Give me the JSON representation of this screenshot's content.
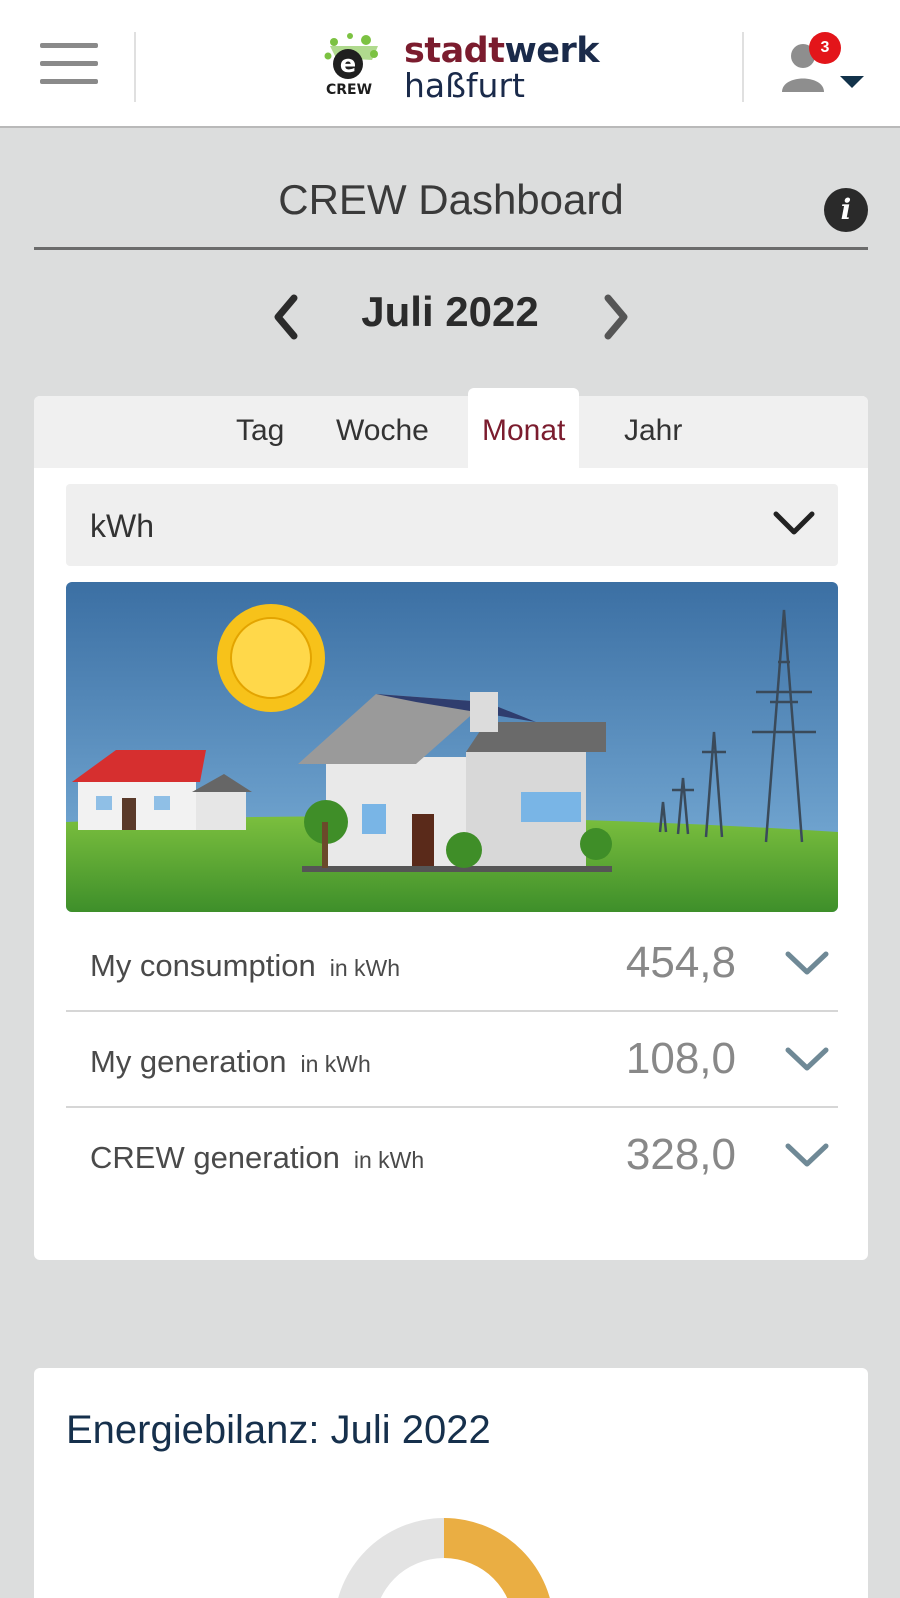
{
  "header": {
    "logo": {
      "brand_part1": "stadt",
      "brand_part2": "werk",
      "brand_line2": "haßfurt",
      "crew_label": "CREW"
    },
    "notifications_count": "3"
  },
  "page_title": "CREW Dashboard",
  "period": {
    "label": "Juli 2022"
  },
  "tabs": [
    {
      "label": "Tag",
      "active": false
    },
    {
      "label": "Woche",
      "active": false
    },
    {
      "label": "Monat",
      "active": true
    },
    {
      "label": "Jahr",
      "active": false
    }
  ],
  "unit_select": {
    "value": "kWh"
  },
  "stats": [
    {
      "label": "My consumption",
      "unit": "in kWh",
      "value": "454,8"
    },
    {
      "label": "My generation",
      "unit": "in kWh",
      "value": "108,0"
    },
    {
      "label": "CREW generation",
      "unit": "in kWh",
      "value": "328,0"
    }
  ],
  "energy_balance": {
    "title": "Energiebilanz: Juli 2022"
  },
  "colors": {
    "brand_red": "#7b1c2e",
    "brand_navy": "#16304c",
    "badge_red": "#e3151a",
    "donut_orange": "#eaae43"
  }
}
